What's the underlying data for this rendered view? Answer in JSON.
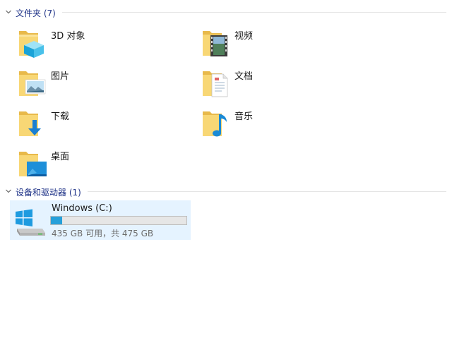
{
  "groups": {
    "folders": {
      "title": "文件夹 (7)"
    },
    "drives": {
      "title": "设备和驱动器 (1)"
    }
  },
  "folders": [
    {
      "label": "3D 对象",
      "icon": "3d-objects-folder-icon"
    },
    {
      "label": "视频",
      "icon": "videos-folder-icon"
    },
    {
      "label": "图片",
      "icon": "pictures-folder-icon"
    },
    {
      "label": "文档",
      "icon": "documents-folder-icon"
    },
    {
      "label": "下载",
      "icon": "downloads-folder-icon"
    },
    {
      "label": "音乐",
      "icon": "music-folder-icon"
    },
    {
      "label": "桌面",
      "icon": "desktop-folder-icon"
    }
  ],
  "drive": {
    "name": "Windows (C:)",
    "free_text": "435 GB 可用，共 475 GB",
    "used_fraction": 0.084,
    "icon": "windows-drive-icon"
  },
  "colors": {
    "accent": "#26a0da",
    "header_text": "#1e3287",
    "selection_bg": "#e5f3ff",
    "folder_yellow": "#f8d775"
  }
}
